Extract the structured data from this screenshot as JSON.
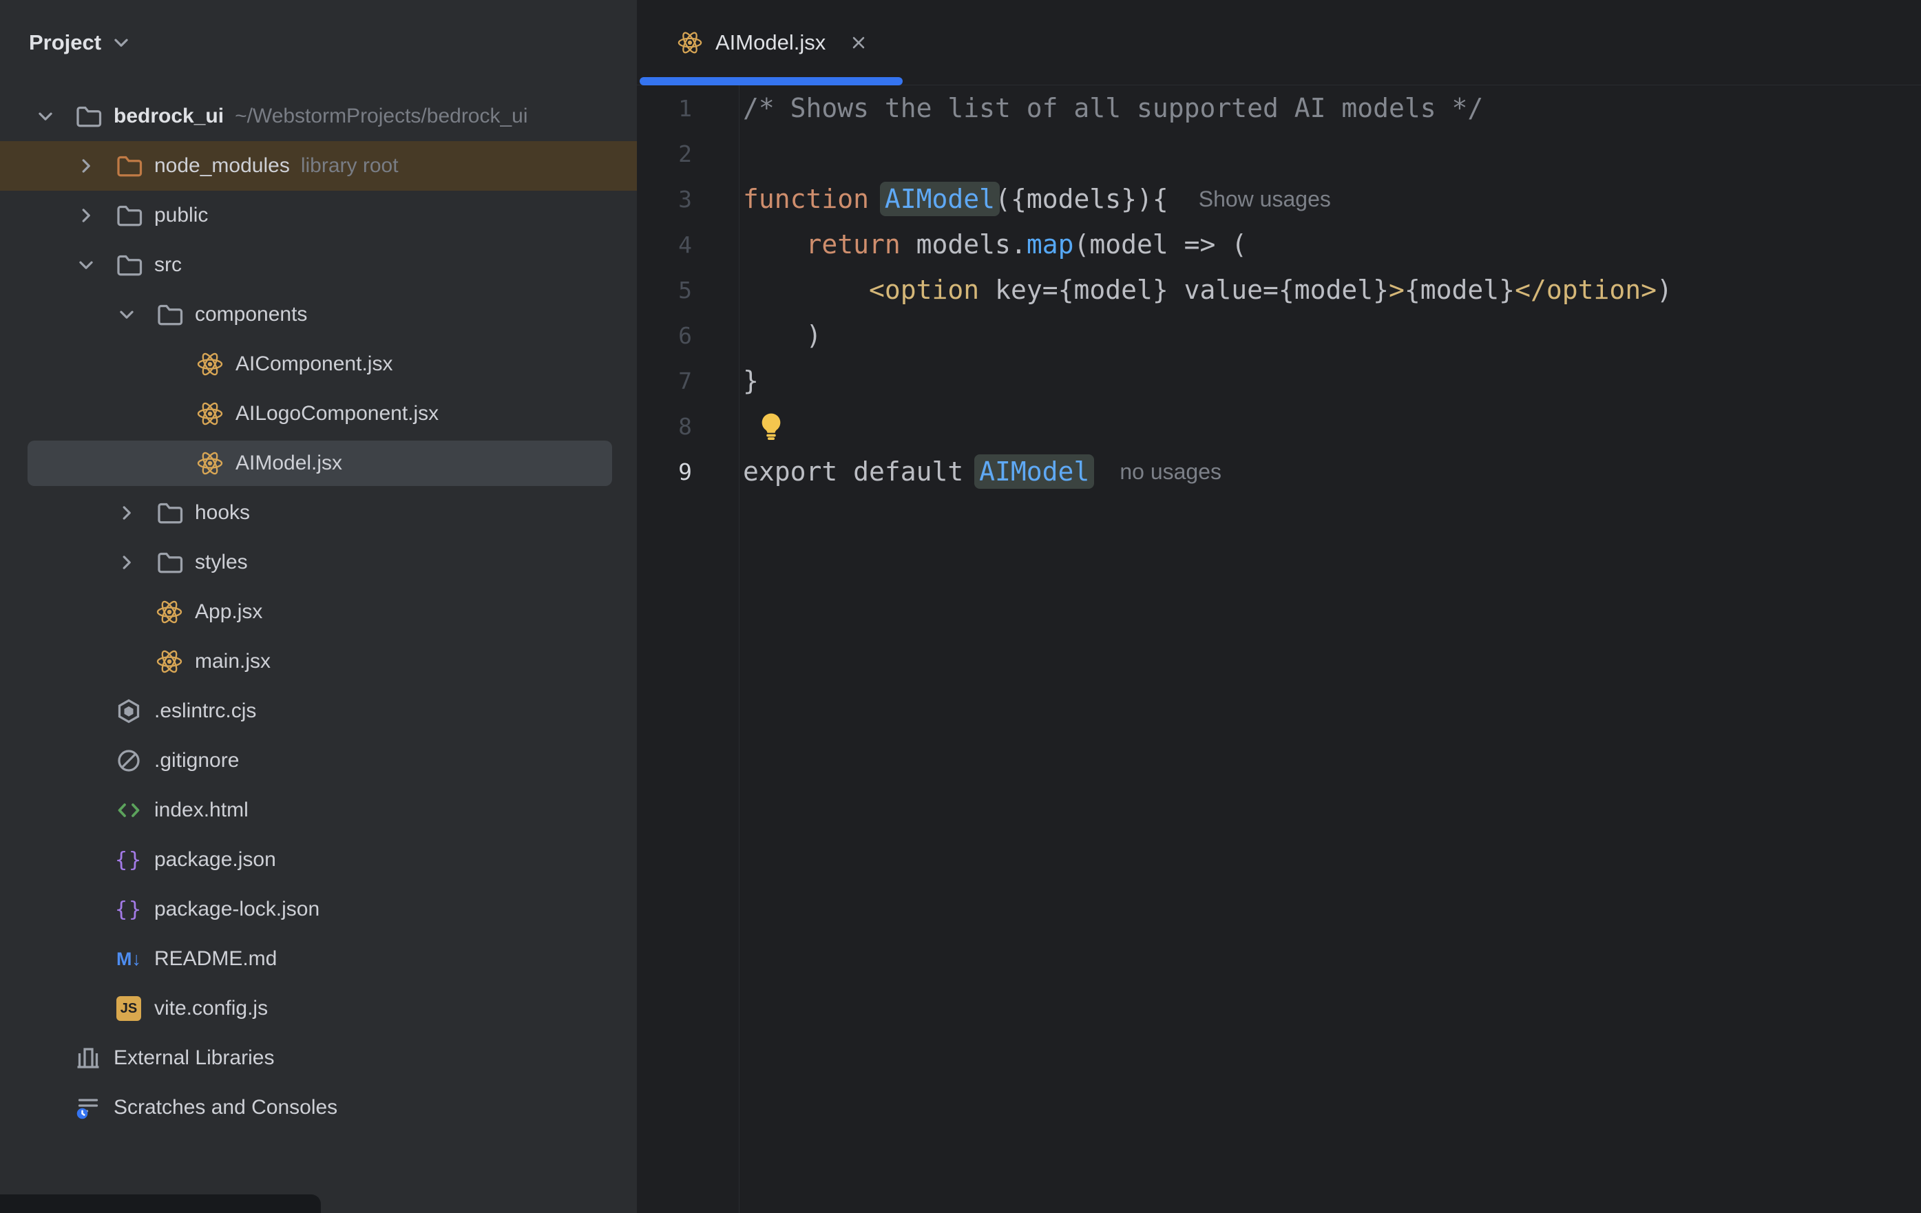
{
  "colors": {
    "accent": "#3574F0",
    "panel_bg": "#2B2D30",
    "editor_bg": "#1E1F22",
    "selection_row": "#3E4247",
    "library_row": "#473A26",
    "keyword": "#CF8E6D",
    "function_name": "#5FA9F5",
    "tag": "#D5B778",
    "comment": "#848890"
  },
  "sidebar": {
    "header": {
      "label": "Project"
    },
    "items": [
      {
        "label": "bedrock_ui",
        "meta": "~/WebstormProjects/bedrock_ui",
        "icon": "folder",
        "level": 0,
        "chevron": "open",
        "bold": true
      },
      {
        "label": "node_modules",
        "meta": "library root",
        "icon": "folder-excluded",
        "level": 1,
        "chevron": "closed",
        "state": "highlighted"
      },
      {
        "label": "public",
        "icon": "folder",
        "level": 1,
        "chevron": "closed"
      },
      {
        "label": "src",
        "icon": "folder",
        "level": 1,
        "chevron": "open"
      },
      {
        "label": "components",
        "icon": "folder",
        "level": 2,
        "chevron": "open"
      },
      {
        "label": "AIComponent.jsx",
        "icon": "react",
        "level": 3
      },
      {
        "label": "AILogoComponent.jsx",
        "icon": "react",
        "level": 3
      },
      {
        "label": "AIModel.jsx",
        "icon": "react",
        "level": 3,
        "state": "selected"
      },
      {
        "label": "hooks",
        "icon": "folder",
        "level": 2,
        "chevron": "closed"
      },
      {
        "label": "styles",
        "icon": "folder",
        "level": 2,
        "chevron": "closed"
      },
      {
        "label": "App.jsx",
        "icon": "react",
        "level": 2
      },
      {
        "label": "main.jsx",
        "icon": "react",
        "level": 2
      },
      {
        "label": ".eslintrc.cjs",
        "icon": "eslint",
        "level": 1
      },
      {
        "label": ".gitignore",
        "icon": "ignore",
        "level": 1
      },
      {
        "label": "index.html",
        "icon": "html",
        "level": 1
      },
      {
        "label": "package.json",
        "icon": "json",
        "level": 1
      },
      {
        "label": "package-lock.json",
        "icon": "json",
        "level": 1
      },
      {
        "label": "README.md",
        "icon": "markdown",
        "level": 1
      },
      {
        "label": "vite.config.js",
        "icon": "js",
        "level": 1
      },
      {
        "label": "External Libraries",
        "icon": "libraries",
        "level": 0
      },
      {
        "label": "Scratches and Consoles",
        "icon": "scratches",
        "level": 0
      }
    ]
  },
  "editor": {
    "tab": {
      "label": "AIModel.jsx",
      "icon": "react",
      "active": true
    },
    "lines": [
      {
        "n": "1",
        "tokens": [
          {
            "t": "/* Shows the list of all supported AI models */",
            "s": "comment"
          }
        ]
      },
      {
        "n": "2",
        "tokens": []
      },
      {
        "n": "3",
        "tokens": [
          {
            "t": "function ",
            "s": "kw"
          },
          {
            "t": "AIModel",
            "s": "fn-hl"
          },
          {
            "t": "({models}){",
            "s": "plain"
          },
          {
            "t": "Show usages",
            "s": "inlay"
          }
        ]
      },
      {
        "n": "4",
        "tokens": [
          {
            "t": "    ",
            "s": "plain"
          },
          {
            "t": "return ",
            "s": "kw"
          },
          {
            "t": "models.",
            "s": "plain"
          },
          {
            "t": "map",
            "s": "method"
          },
          {
            "t": "(model => (",
            "s": "plain"
          }
        ]
      },
      {
        "n": "5",
        "tokens": [
          {
            "t": "        ",
            "s": "plain"
          },
          {
            "t": "<option",
            "s": "tag"
          },
          {
            "t": " key={model} value={model}",
            "s": "plain"
          },
          {
            "t": ">",
            "s": "tag"
          },
          {
            "t": "{model}",
            "s": "plain"
          },
          {
            "t": "</option>",
            "s": "tag"
          },
          {
            "t": ")",
            "s": "plain"
          }
        ]
      },
      {
        "n": "6",
        "tokens": [
          {
            "t": "    )",
            "s": "plain"
          }
        ]
      },
      {
        "n": "7",
        "tokens": [
          {
            "t": "}",
            "s": "plain"
          }
        ]
      },
      {
        "n": "8",
        "tokens": [
          {
            "t": "",
            "s": "bulb"
          }
        ]
      },
      {
        "n": "9",
        "active": true,
        "tokens": [
          {
            "t": "export default ",
            "s": "plain"
          },
          {
            "t": "AIModel",
            "s": "fn-hl"
          },
          {
            "t": "no usages",
            "s": "inlay"
          }
        ]
      }
    ]
  }
}
